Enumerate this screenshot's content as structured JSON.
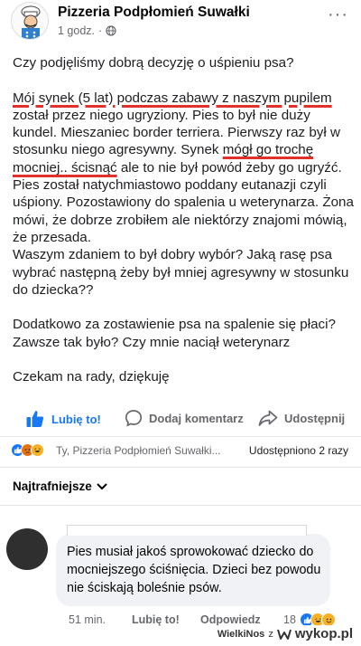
{
  "post": {
    "page_name": "Pizzeria Podpłomień Suwałki",
    "time": "1 godz.",
    "more": "···"
  },
  "body": {
    "p1": "Czy podjęliśmy dobrą decyzję o uśpieniu psa?",
    "p2_u1": "Mój synek (5 lat) podczas zabawy z naszym pupilem",
    "p2_a": " został przez niego ugryziony. Pies to był nie duży kundel. Mieszaniec border terriera. Pierwszy raz był w stosunku niego agresywny. Synek ",
    "p2_u2": "mógł go trochę",
    "p2_u3": "mocniej.. ścisnąć",
    "p2_b": " ale to nie był powód żeby go ugryźć. Pies został natychmiastowo poddany eutanazji czyli uśpiony. Pozostawiony do spalenia u weterynarza. Żona mówi, że dobrze zrobiłem ale niektórzy znajomi mówią, że przesada.",
    "p3": "Waszym zdaniem to był dobry wybór? Jaką rasę psa wybrać następną żeby był mniej agresywny w stosunku do dziecka??",
    "p4": "Dodatkowo za zostawienie psa na spalenie się płaci? Zawsze tak było? Czy mnie naciął weterynarz",
    "p5": "Czekam na rady, dziękuję"
  },
  "actions": {
    "like": "Lubię to!",
    "comment": "Dodaj komentarz",
    "share": "Udostępnij"
  },
  "reactions": {
    "names": "Ty, Pizzeria Podpłomień Suwałki...",
    "shares": "Udostępniono 2 razy"
  },
  "sort": {
    "label": "Najtrafniejsze"
  },
  "comment": {
    "text": "Pies musiał jakoś sprowokować dziecko do mocniejszego ściśnięcia. Dzieci bez powodu nie ściskają boleśnie psów.",
    "time": "51 min.",
    "like": "Lubię to!",
    "reply": "Odpowiedz",
    "count": "18"
  },
  "watermark": {
    "user": "WielkiNos",
    "sep": "z",
    "site": "wykop.pl"
  },
  "colors": {
    "accent": "#1877f2",
    "underline": "#e0322a"
  }
}
